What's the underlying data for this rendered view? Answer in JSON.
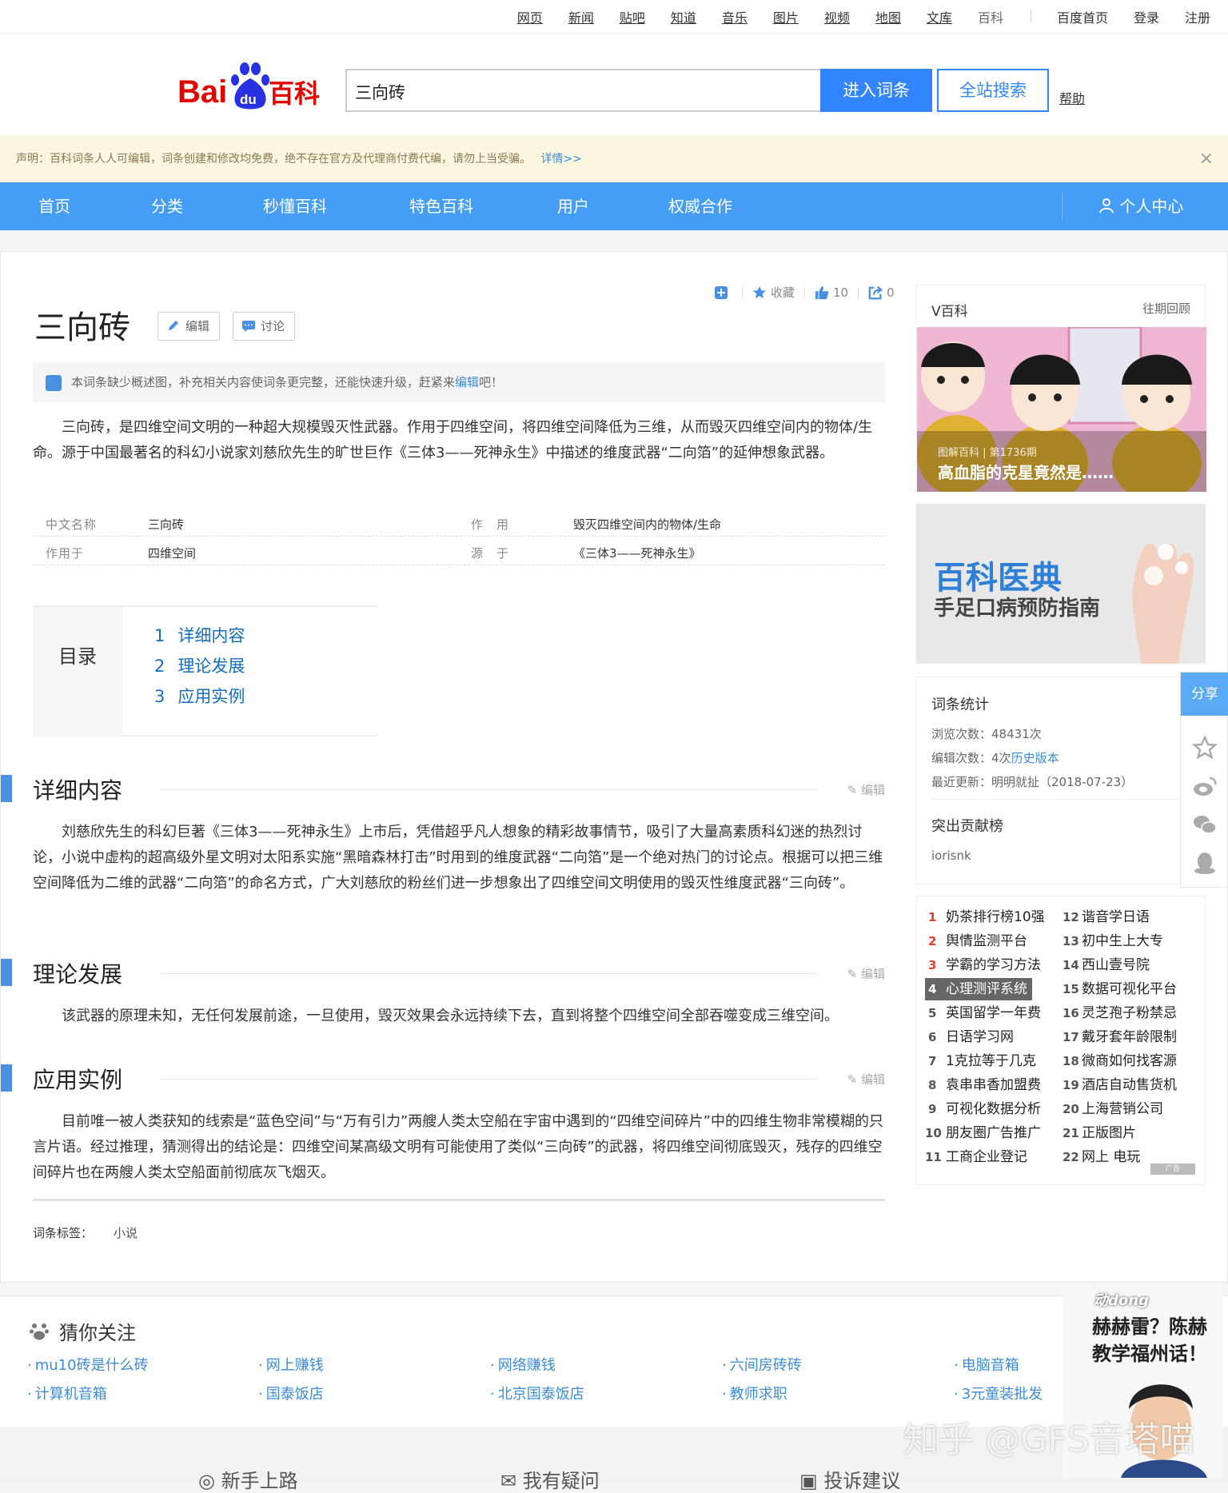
{
  "topnav": {
    "links": [
      "网页",
      "新闻",
      "贴吧",
      "知道",
      "音乐",
      "图片",
      "视频",
      "地图",
      "文库",
      "百科"
    ],
    "right": [
      "百度首页",
      "登录",
      "注册"
    ]
  },
  "header": {
    "logo_text": "Bai du 百科",
    "search_value": "三向砖",
    "enter_button": "进入词条",
    "site_search_button": "全站搜索",
    "help": "帮助"
  },
  "notice": {
    "text": "声明：百科词条人人可编辑，词条创建和修改均免费，绝不存在官方及代理商付费代编，请勿上当受骗。",
    "more": "详情>>",
    "close": "×"
  },
  "mainnav": {
    "items": [
      "首页",
      "分类",
      "秒懂百科",
      "特色百科",
      "用户",
      "权威合作"
    ],
    "personal": "个人中心"
  },
  "entry": {
    "title": "三向砖",
    "edit_btn": "编辑",
    "discuss_btn": "讨论",
    "actions": {
      "collect": "收藏",
      "likes": "10",
      "shares": "0"
    },
    "tip_prefix": "本词条缺少概述图，补充相关内容使词条更完整，还能快速升级，赶紧来",
    "tip_link": "编辑",
    "tip_suffix": "吧！",
    "summary": "三向砖，是四维空间文明的一种超大规模毁灭性武器。作用于四维空间，将四维空间降低为三维，从而毁灭四维空间内的物体/生命。源于中国最著名的科幻小说家刘慈欣先生的旷世巨作《三体3——死神永生》中描述的维度武器“二向箔”的延伸想象武器。",
    "basic_info": [
      {
        "k1": "中文名称",
        "v1": "三向砖",
        "k2": "作　用",
        "v2": "毁灭四维空间内的物体/生命"
      },
      {
        "k1": "作用于",
        "v1": "四维空间",
        "k2": "源　于",
        "v2": "《三体3——死神永生》"
      }
    ],
    "toc_title": "目录",
    "toc": [
      {
        "n": "1",
        "label": "详细内容"
      },
      {
        "n": "2",
        "label": "理论发展"
      },
      {
        "n": "3",
        "label": "应用实例"
      }
    ],
    "sections": [
      {
        "title": "详细内容",
        "edit": "编辑",
        "text": "刘慈欣先生的科幻巨著《三体3——死神永生》上市后，凭借超乎凡人想象的精彩故事情节，吸引了大量高素质科幻迷的热烈讨论，小说中虚构的超高级外星文明对太阳系实施“黑暗森林打击”时用到的维度武器“二向箔”是一个绝对热门的讨论点。根据可以把三维空间降低为二维的武器“二向箔”的命名方式，广大刘慈欣的粉丝们进一步想象出了四维空间文明使用的毁灭性维度武器“三向砖”。"
      },
      {
        "title": "理论发展",
        "edit": "编辑",
        "text": "该武器的原理未知，无任何发展前途，一旦使用，毁灭效果会永远持续下去，直到将整个四维空间全部吞噬变成三维空间。"
      },
      {
        "title": "应用实例",
        "edit": "编辑",
        "text": "目前唯一被人类获知的线索是“蓝色空间”与“万有引力”两艘人类太空船在宇宙中遇到的“四维空间碎片”中的四维生物非常模糊的只言片语。经过推理，猜测得出的结论是：四维空间某高级文明有可能使用了类似“三向砖”的武器，将四维空间彻底毁灭，残存的四维空间碎片也在两艘人类太空船面前彻底灰飞烟灭。"
      }
    ],
    "tags_label": "词条标签：",
    "tags": [
      "小说"
    ]
  },
  "sidebar": {
    "vbaike": {
      "title": "V百科",
      "more": "往期回顾",
      "caption_small": "图解百科 | 第1736期",
      "caption": "高血脂的克星竟然是……"
    },
    "ad": {
      "title": "百科医典",
      "subtitle": "手足口病预防指南"
    },
    "stats": {
      "title": "词条统计",
      "views_label": "浏览次数：",
      "views": "48431次",
      "edits_label": "编辑次数：",
      "edits": "4次",
      "history": "历史版本",
      "updated_label": "最近更新：",
      "updated": "明明就扯（2018-07-23）",
      "contrib_title": "突出贡献榜",
      "contributor": "iorisnk"
    },
    "share": "分享",
    "rank_left": [
      {
        "n": "1",
        "t": "奶茶排行榜10强"
      },
      {
        "n": "2",
        "t": "舆情监测平台"
      },
      {
        "n": "3",
        "t": "学霸的学习方法"
      },
      {
        "n": "4",
        "t": "心理测评系统"
      },
      {
        "n": "5",
        "t": "英国留学一年费"
      },
      {
        "n": "6",
        "t": "日语学习网"
      },
      {
        "n": "7",
        "t": "1克拉等于几克"
      },
      {
        "n": "8",
        "t": "袁串串香加盟费"
      },
      {
        "n": "9",
        "t": "可视化数据分析"
      },
      {
        "n": "10",
        "t": "朋友圈广告推广"
      },
      {
        "n": "11",
        "t": "工商企业登记"
      }
    ],
    "rank_right": [
      {
        "n": "12",
        "t": "谐音学日语"
      },
      {
        "n": "13",
        "t": "初中生上大专"
      },
      {
        "n": "14",
        "t": "西山壹号院"
      },
      {
        "n": "15",
        "t": "数据可视化平台"
      },
      {
        "n": "16",
        "t": "灵芝孢子粉禁忌"
      },
      {
        "n": "17",
        "t": "戴牙套年龄限制"
      },
      {
        "n": "18",
        "t": "微商如何找客源"
      },
      {
        "n": "19",
        "t": "酒店自动售货机"
      },
      {
        "n": "20",
        "t": "上海营销公司"
      },
      {
        "n": "21",
        "t": "正版图片"
      },
      {
        "n": "22",
        "t": "网上 电玩"
      }
    ],
    "ad_tag": "广告"
  },
  "guess": {
    "title": "猜你关注",
    "row1": [
      "mu10砖是什么砖",
      "网上赚钱",
      "网络赚钱",
      "六间房砖砖",
      "电脑音箱"
    ],
    "row2": [
      "计算机音箱",
      "国泰饭店",
      "北京国泰饭店",
      "教师求职",
      "3元童装批发"
    ]
  },
  "bottom": [
    "新手上路",
    "我有疑问",
    "投诉建议"
  ],
  "watermark": "知乎 @GFS音塔喵",
  "video_ad": {
    "brand": "动dong",
    "text": "赫赫雷？陈赫教学福州话！"
  },
  "colors": {
    "brand_blue": "#3385ff",
    "nav_blue": "#459df5",
    "link": "#136ec2"
  }
}
